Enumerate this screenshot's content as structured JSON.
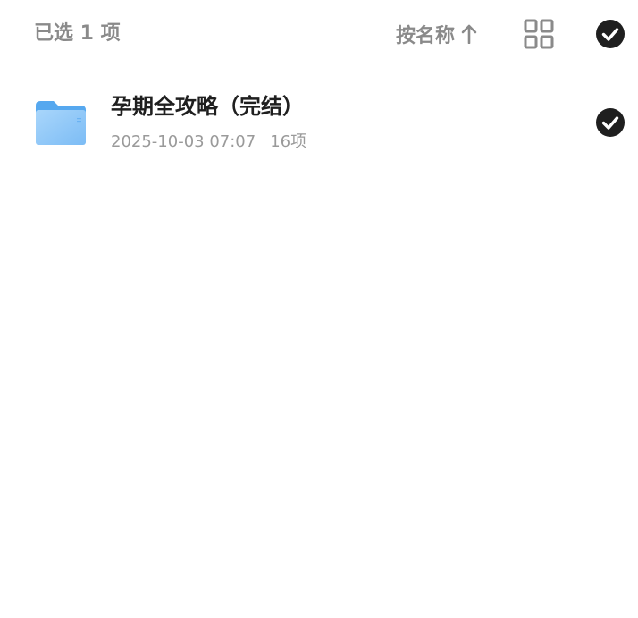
{
  "header": {
    "selected_label": "已选 1 项",
    "sort_label": "按名称",
    "sort_direction_icon": "arrow-up-icon",
    "view_toggle_icon": "grid-view-icon",
    "select_all_icon": "check-circle-icon"
  },
  "files": [
    {
      "name": "孕期全攻略（完结）",
      "date": "2025-10-03 07:07",
      "item_count": "16项",
      "type_icon": "folder-icon",
      "selected": true
    }
  ],
  "colors": {
    "muted_text": "#8a8a8a",
    "primary_text": "#1f1f1f",
    "check_fill": "#1f1f1f",
    "folder_blue": "#7cbcf5"
  }
}
